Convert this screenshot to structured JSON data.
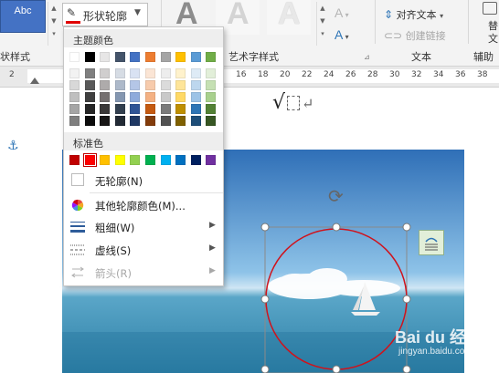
{
  "ribbon": {
    "style_box_label": "Abc",
    "shape_styles_group_label": "状样式",
    "shape_outline_label": "形状轮廓",
    "art_text_group_label": "艺术字样式",
    "text_group_label": "文本",
    "align_text_label": "对齐文本",
    "create_link_label": "创建链接",
    "aux_group_label": "辅助功",
    "alt_text_label_1": "替",
    "alt_text_label_2": "文",
    "art_letter": "A",
    "text_fill_glyph": "A",
    "text_effects_glyph": "A"
  },
  "ruler": {
    "numbers": [
      "2",
      "16",
      "18",
      "20",
      "22",
      "24",
      "26",
      "28",
      "30",
      "32",
      "34",
      "36",
      "38"
    ]
  },
  "document": {
    "formula_text": "√",
    "return_mark": "↵",
    "anchor_glyph": "⚓",
    "rotate_glyph": "⟳"
  },
  "dropdown": {
    "theme_colors_header": "主题颜色",
    "standard_colors_header": "标准色",
    "no_outline_label": "无轮廓(N)",
    "more_colors_label": "其他轮廓颜色(M)...",
    "weight_label": "粗细(W)",
    "dashes_label": "虚线(S)",
    "arrows_label": "箭头(R)",
    "submenu_arrow": "▶",
    "theme_top_row": [
      "#ffffff",
      "#000000",
      "#e7e6e6",
      "#44546a",
      "#4472c4",
      "#ed7d31",
      "#a5a5a5",
      "#ffc000",
      "#5b9bd5",
      "#70ad47"
    ],
    "theme_shades": [
      [
        "#f2f2f2",
        "#7f7f7f",
        "#d0cece",
        "#d6dce4",
        "#d9e2f3",
        "#fbe5d5",
        "#ededed",
        "#fff2cc",
        "#deebf6",
        "#e2efd9"
      ],
      [
        "#d8d8d8",
        "#595959",
        "#aeabab",
        "#adb9ca",
        "#b4c6e7",
        "#f7cbac",
        "#dbdbdb",
        "#fee599",
        "#bdd7ee",
        "#c5e0b3"
      ],
      [
        "#bfbfbf",
        "#3f3f3f",
        "#757070",
        "#8496b0",
        "#8eaadb",
        "#f4b183",
        "#c9c9c9",
        "#ffd965",
        "#9dc3e6",
        "#a8d08d"
      ],
      [
        "#a5a5a5",
        "#262626",
        "#3a3838",
        "#323f4f",
        "#2f5496",
        "#c55a11",
        "#7b7b7b",
        "#bf8f00",
        "#2e75b5",
        "#538135"
      ],
      [
        "#7f7f7f",
        "#0c0c0c",
        "#171616",
        "#222a35",
        "#1f3864",
        "#833c0b",
        "#525252",
        "#7f6000",
        "#1e4e79",
        "#375623"
      ]
    ],
    "standard_colors": [
      "#c00000",
      "#ff0000",
      "#ffc000",
      "#ffff00",
      "#92d050",
      "#00b050",
      "#00b0f0",
      "#0070c0",
      "#002060",
      "#7030a0"
    ],
    "selected_standard_index": 1
  },
  "watermark": {
    "brand": "Bai du 经验",
    "url": "jingyan.baidu.com"
  }
}
